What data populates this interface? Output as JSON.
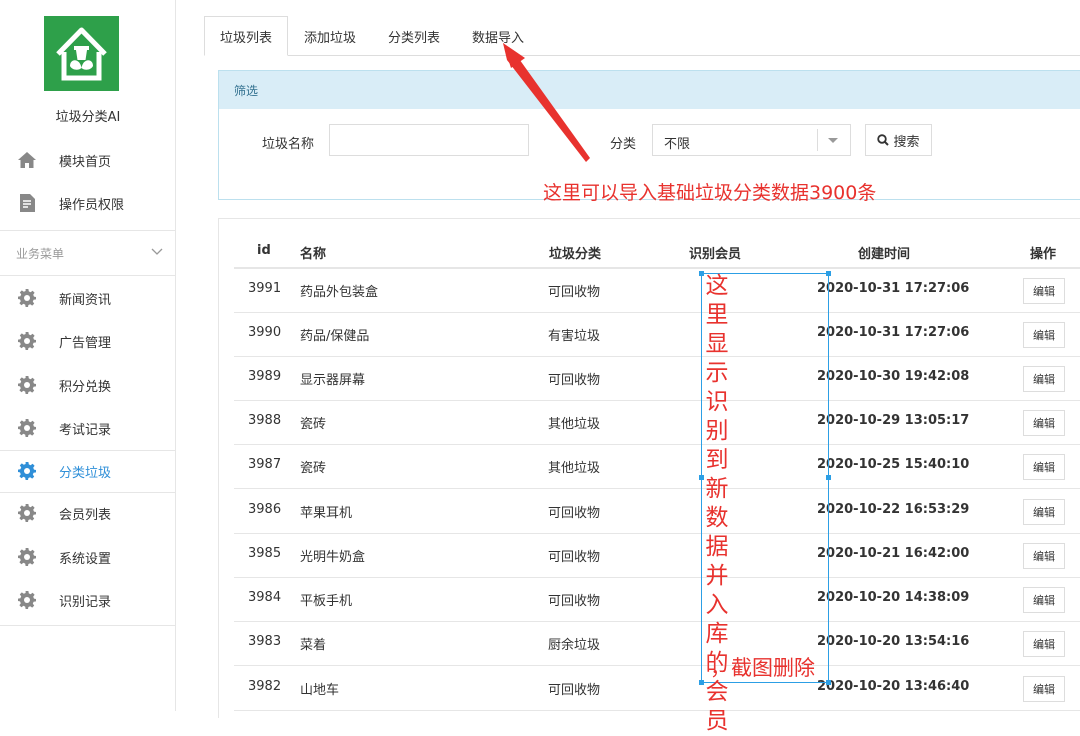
{
  "app": {
    "name": "垃圾分类AI"
  },
  "sidebar": {
    "top_items": [
      {
        "label": "模块首页",
        "icon": "home-icon"
      },
      {
        "label": "操作员权限",
        "icon": "document-icon"
      }
    ],
    "section": {
      "label": "业务菜单"
    },
    "items": [
      {
        "label": "新闻资讯",
        "icon": "gear-icon"
      },
      {
        "label": "广告管理",
        "icon": "gear-icon"
      },
      {
        "label": "积分兑换",
        "icon": "gear-icon"
      },
      {
        "label": "考试记录",
        "icon": "gear-icon"
      },
      {
        "label": "分类垃圾",
        "icon": "gear-icon",
        "active": true
      },
      {
        "label": "会员列表",
        "icon": "gear-icon"
      },
      {
        "label": "系统设置",
        "icon": "gear-icon"
      },
      {
        "label": "识别记录",
        "icon": "gear-icon"
      }
    ]
  },
  "tabs": [
    {
      "label": "垃圾列表",
      "active": true
    },
    {
      "label": "添加垃圾"
    },
    {
      "label": "分类列表"
    },
    {
      "label": "数据导入"
    }
  ],
  "filter": {
    "title": "筛选",
    "name_label": "垃圾名称",
    "name_value": "",
    "category_label": "分类",
    "category_value": "不限",
    "search_label": "搜索"
  },
  "table": {
    "headers": {
      "id": "id",
      "name": "名称",
      "category": "垃圾分类",
      "member": "识别会员",
      "created": "创建时间",
      "action": "操作"
    },
    "edit_label": "编辑",
    "rows": [
      {
        "id": "3991",
        "name": "药品外包装盒",
        "category": "可回收物",
        "member": "",
        "created": "2020-10-31 17:27:06"
      },
      {
        "id": "3990",
        "name": "药品/保健品",
        "category": "有害垃圾",
        "member": "",
        "created": "2020-10-31 17:27:06"
      },
      {
        "id": "3989",
        "name": "显示器屏幕",
        "category": "可回收物",
        "member": "",
        "created": "2020-10-30 19:42:08"
      },
      {
        "id": "3988",
        "name": "瓷砖",
        "category": "其他垃圾",
        "member": "",
        "created": "2020-10-29 13:05:17"
      },
      {
        "id": "3987",
        "name": "瓷砖",
        "category": "其他垃圾",
        "member": "",
        "created": "2020-10-25 15:40:10"
      },
      {
        "id": "3986",
        "name": "苹果耳机",
        "category": "可回收物",
        "member": "",
        "created": "2020-10-22 16:53:29"
      },
      {
        "id": "3985",
        "name": "光明牛奶盒",
        "category": "可回收物",
        "member": "",
        "created": "2020-10-21 16:42:00"
      },
      {
        "id": "3984",
        "name": "平板手机",
        "category": "可回收物",
        "member": "",
        "created": "2020-10-20 14:38:09"
      },
      {
        "id": "3983",
        "name": "菜着",
        "category": "厨余垃圾",
        "member": "",
        "created": "2020-10-20 13:54:16"
      },
      {
        "id": "3982",
        "name": "山地车",
        "category": "可回收物",
        "member": "",
        "created": "2020-10-20 13:46:40"
      }
    ]
  },
  "annotations": {
    "import_note": "这里可以导入基础垃圾分类数据3900条",
    "member_note": "这里显示识别到新数据并入库的会员",
    "member_note_tail": "，截图删除",
    "color": "#e8322e",
    "box_color": "#2c9fe5"
  }
}
